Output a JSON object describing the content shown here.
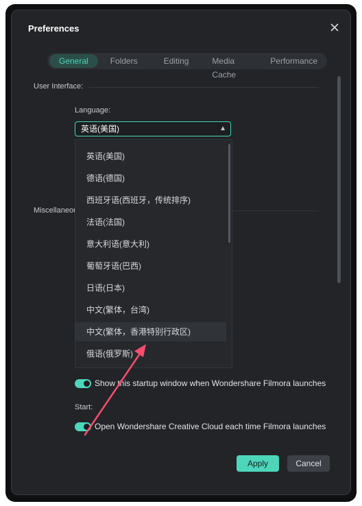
{
  "dialog": {
    "title": "Preferences",
    "close_icon": "close-icon"
  },
  "tabs": [
    {
      "label": "General",
      "active": true
    },
    {
      "label": "Folders",
      "active": false
    },
    {
      "label": "Editing",
      "active": false
    },
    {
      "label": "Media Cache",
      "active": false
    },
    {
      "label": "Performance",
      "active": false
    }
  ],
  "sections": {
    "user_interface": "User Interface:",
    "miscellaneous": "Miscellaneou"
  },
  "language": {
    "label": "Language:",
    "selected": "英语(美国)",
    "chevron_icon": "chevron-up-icon",
    "options": [
      "英语(美国)",
      "德语(德国)",
      "西班牙语(西班牙，传统排序)",
      "法语(法国)",
      "意大利语(意大利)",
      "葡萄牙语(巴西)",
      "日语(日本)",
      "中文(繁体，台湾)",
      "中文(繁体，香港特别行政区)",
      "俄语(俄罗斯)"
    ],
    "hovered_index": 8
  },
  "toggles": {
    "startup_window": {
      "label": "Show this startup window when Wondershare Filmora launches",
      "on": true
    },
    "start_label": "Start:",
    "creative_cloud": {
      "label": "Open Wondershare Creative Cloud each time Filmora launches",
      "on": true
    }
  },
  "buttons": {
    "apply": "Apply",
    "cancel": "Cancel"
  },
  "colors": {
    "accent": "#4ed6ba",
    "annotation_arrow": "#ff4d6d"
  }
}
